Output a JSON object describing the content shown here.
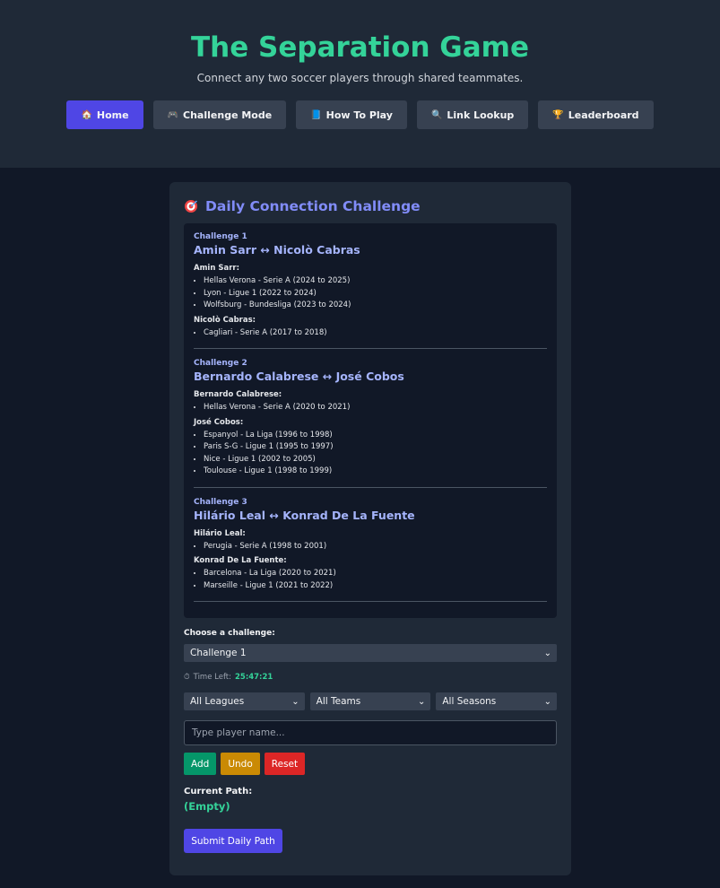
{
  "header": {
    "title": "The Separation Game",
    "subtitle": "Connect any two soccer players through shared teammates.",
    "nav": [
      {
        "icon": "🏠",
        "label": "Home"
      },
      {
        "icon": "🎮",
        "label": "Challenge Mode"
      },
      {
        "icon": "📘",
        "label": "How To Play"
      },
      {
        "icon": "🔍",
        "label": "Link Lookup"
      },
      {
        "icon": "🏆",
        "label": "Leaderboard"
      }
    ]
  },
  "daily": {
    "title": "Daily Connection Challenge",
    "challenges": [
      {
        "label": "Challenge 1",
        "title": "Amin Sarr ↔ Nicolò Cabras",
        "players": [
          {
            "name": "Amin Sarr:",
            "clubs": [
              "Hellas Verona - Serie A (2024 to 2025)",
              "Lyon - Ligue 1 (2022 to 2024)",
              "Wolfsburg - Bundesliga (2023 to 2024)"
            ]
          },
          {
            "name": "Nicolò Cabras:",
            "clubs": [
              "Cagliari - Serie A (2017 to 2018)"
            ]
          }
        ]
      },
      {
        "label": "Challenge 2",
        "title": "Bernardo Calabrese ↔ José Cobos",
        "players": [
          {
            "name": "Bernardo Calabrese:",
            "clubs": [
              "Hellas Verona - Serie A (2020 to 2021)"
            ]
          },
          {
            "name": "José Cobos:",
            "clubs": [
              "Espanyol - La Liga (1996 to 1998)",
              "Paris S-G - Ligue 1 (1995 to 1997)",
              "Nice - Ligue 1 (2002 to 2005)",
              "Toulouse - Ligue 1 (1998 to 1999)"
            ]
          }
        ]
      },
      {
        "label": "Challenge 3",
        "title": "Hilário Leal ↔ Konrad De La Fuente",
        "players": [
          {
            "name": "Hilário Leal:",
            "clubs": [
              "Perugia - Serie A (1998 to 2001)"
            ]
          },
          {
            "name": "Konrad De La Fuente:",
            "clubs": [
              "Barcelona - La Liga (2020 to 2021)",
              "Marseille - Ligue 1 (2021 to 2022)"
            ]
          }
        ]
      }
    ],
    "choose_label": "Choose a challenge:",
    "selected_challenge": "Challenge 1",
    "timer_label": "Time Left:",
    "timer_value": "25:47:21",
    "filters": {
      "league": "All Leagues",
      "team": "All Teams",
      "season": "All Seasons"
    },
    "player_placeholder": "Type player name...",
    "buttons": {
      "add": "Add",
      "undo": "Undo",
      "reset": "Reset"
    },
    "path_label": "Current Path:",
    "path_value": "(Empty)",
    "submit_label": "Submit Daily Path"
  },
  "colors": {
    "accent": "#4f46e5",
    "title_green": "#34d399",
    "add": "#059669",
    "undo": "#ca8a04",
    "reset": "#dc2626"
  }
}
